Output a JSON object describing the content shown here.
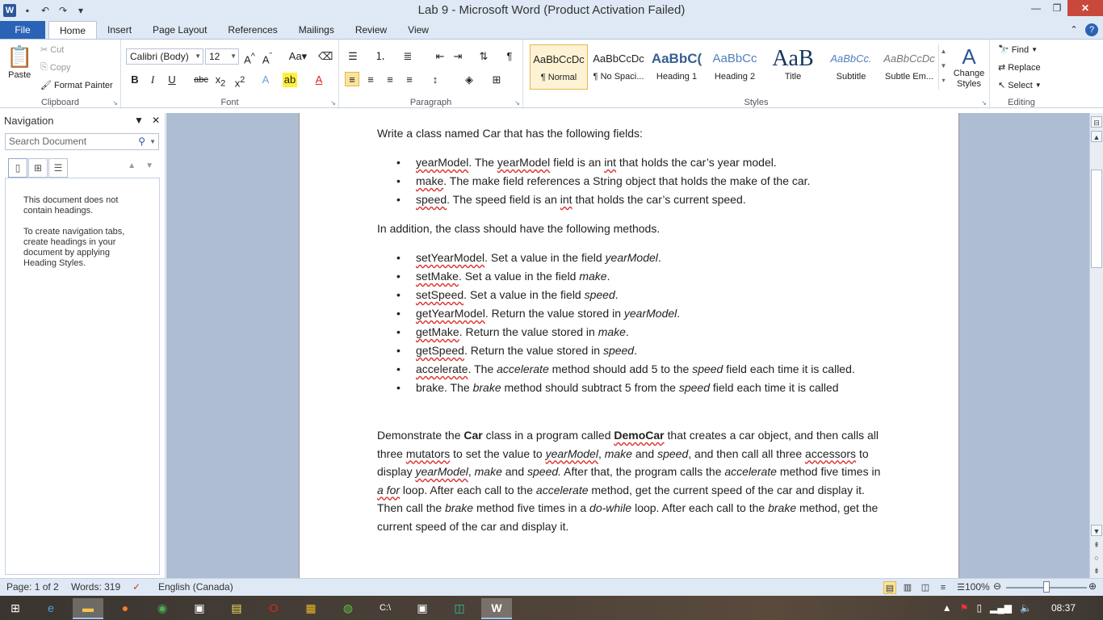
{
  "window": {
    "title": "Lab 9  -  Microsoft Word (Product Activation Failed)",
    "controls": {
      "minimize": "—",
      "restore": "❐",
      "close": "✕"
    }
  },
  "quick_access": {
    "logo": "W",
    "save_icon": "💾",
    "undo_icon": "↶",
    "redo_icon": "↷"
  },
  "tabs": [
    {
      "label": "File"
    },
    {
      "label": "Home"
    },
    {
      "label": "Insert"
    },
    {
      "label": "Page Layout"
    },
    {
      "label": "References"
    },
    {
      "label": "Mailings"
    },
    {
      "label": "Review"
    },
    {
      "label": "View"
    }
  ],
  "ribbon": {
    "clipboard": {
      "label": "Clipboard",
      "paste": "Paste",
      "cut": "Cut",
      "copy": "Copy",
      "format_painter": "Format Painter"
    },
    "font": {
      "label": "Font",
      "font_name": "Calibri (Body)",
      "font_size": "12"
    },
    "paragraph": {
      "label": "Paragraph"
    },
    "styles": {
      "label": "Styles",
      "items": [
        {
          "sample": "AaBbCcDc",
          "name": "¶ Normal"
        },
        {
          "sample": "AaBbCcDc",
          "name": "¶ No Spaci..."
        },
        {
          "sample": "AaBbC(",
          "name": "Heading 1"
        },
        {
          "sample": "AaBbCc",
          "name": "Heading 2"
        },
        {
          "sample": "AaB",
          "name": "Title"
        },
        {
          "sample": "AaBbCc.",
          "name": "Subtitle"
        },
        {
          "sample": "AaBbCcDc",
          "name": "Subtle Em..."
        }
      ],
      "change_styles": "Change Styles"
    },
    "editing": {
      "label": "Editing",
      "find": "Find",
      "replace": "Replace",
      "select": "Select"
    }
  },
  "navigation": {
    "title": "Navigation",
    "search_placeholder": "Search Document",
    "message1": "This document does not contain headings.",
    "message2": "To create navigation tabs, create headings in your document by applying Heading Styles."
  },
  "document": {
    "intro": "Write a class named Car that has the following fields:",
    "fields": [
      {
        "name": "yearModel",
        "text_a": ". The ",
        "em1": "yearModel",
        "text_b": " field is an ",
        "em2": "int",
        "text_c": " that holds the car’s year model."
      },
      {
        "name": "make",
        "text": ". The make field references a String object that holds the make of the car."
      },
      {
        "name": "speed",
        "text_a": ". The speed field is an ",
        "em": "int",
        "text_b": " that holds the car’s current speed."
      }
    ],
    "methods_intro": "In addition, the class should have the following methods.",
    "methods": [
      {
        "name": "setYearModel",
        "text": ". Set a value in the field ",
        "it": "yearModel",
        "end": "."
      },
      {
        "name": "setMake",
        "text": ". Set a value in the field ",
        "it": "make",
        "end": "."
      },
      {
        "name": "setSpeed",
        "text": ". Set a value in the field ",
        "it": "speed",
        "end": "."
      },
      {
        "name": "getYearModel",
        "text": ". Return the value stored in ",
        "it": "yearModel",
        "end": "."
      },
      {
        "name": "getMake",
        "text": ".  Return the value stored in ",
        "it": "make",
        "end": "."
      },
      {
        "name": "getSpeed",
        "text": ". Return the value stored in ",
        "it": "speed",
        "end": "."
      },
      {
        "name": "accelerate",
        "text": ". The ",
        "it": "accelerate",
        "end": " method should add 5 to the ",
        "it2": "speed",
        "end2": " field each time it is called."
      },
      {
        "name": "brake",
        "text": ". The ",
        "it": "brake",
        "end": " method should subtract  5 from the ",
        "it2": "speed",
        "end2": " field each time it is called"
      }
    ],
    "demo": {
      "p1": "Demonstrate the ",
      "car": "Car",
      "p2": " class in a program called ",
      "democar": "DemoCar",
      "p3": " that creates a car object, and then calls all three ",
      "mutators": "mutators",
      "p4": " to set the value to ",
      "i_yearModel": "yearModel",
      "p5": ", ",
      "i_make": "make",
      "p6": " and ",
      "i_speed": "speed",
      "p7": ", and then call all three ",
      "accessors": "accessors",
      "p8": " to display ",
      "i_yearModel2": "yearModel",
      "p9": ", ",
      "i_make2": "make",
      "p10": " and ",
      "i_speed2": "speed.",
      "p11": "  After that, the program calls the ",
      "i_accelerate": "accelerate",
      "p12": " method five times in ",
      "i_afor": "a for",
      "p13": " loop. After each call to the ",
      "i_accelerate2": "accelerate",
      "p14": " method, get the current speed of the car and display it. Then call the ",
      "i_brake": "brake",
      "p15": " method five times in a ",
      "i_dowhile": "do-while",
      "p16": " loop. After each call to the ",
      "i_brake2": "brake",
      "p17": " method, get the current speed of the car and display it."
    }
  },
  "status": {
    "page": "Page: 1 of 2",
    "words": "Words: 319",
    "language": "English (Canada)",
    "zoom": "100%"
  },
  "taskbar": {
    "time": "08:37"
  },
  "colors": {
    "accent": "#2b579a",
    "file_tab": "#2a62b5",
    "doc_background": "#aebdd2",
    "close_button": "#c9483c"
  }
}
